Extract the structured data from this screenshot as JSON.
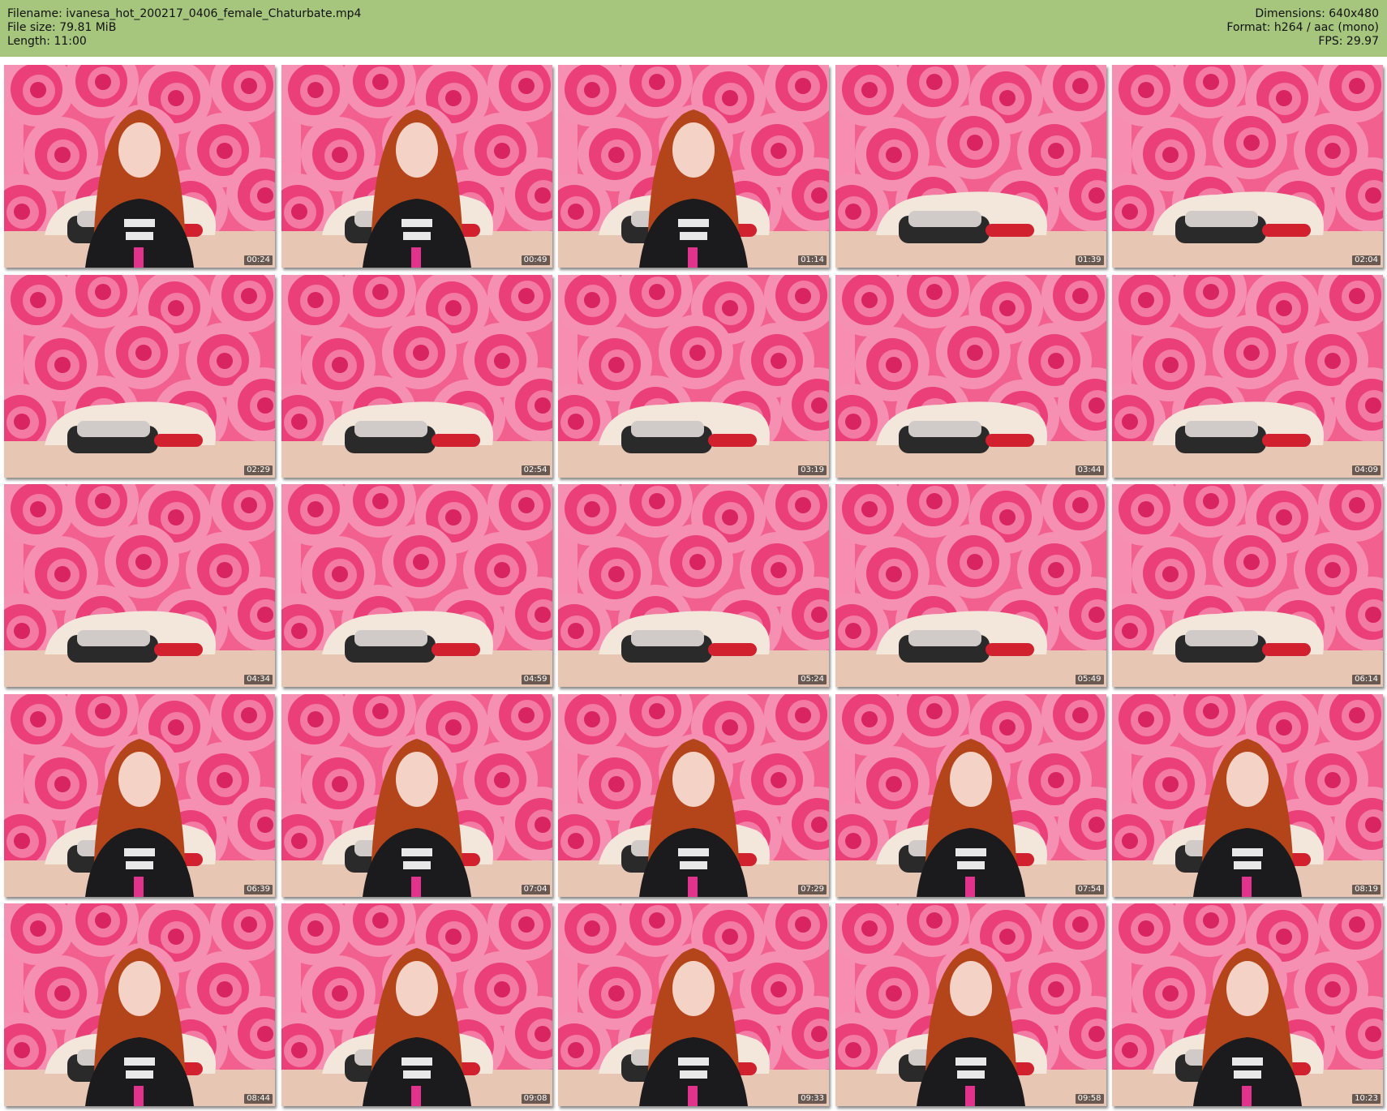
{
  "header": {
    "left": [
      "Filename: ivanesa_hot_200217_0406_female_Chaturbate.mp4",
      "File size: 79.81 MiB",
      "Length: 11:00"
    ],
    "right": [
      "Dimensions: 640x480",
      "Format: h264 / aac (mono)",
      "FPS: 29.97"
    ]
  },
  "colors": {
    "header_bg": "#a7c67d",
    "wallpaper": "#f1608f",
    "hair": "#b4451b",
    "shirt": "#1b1a1c"
  },
  "thumbnails": [
    {
      "time": "00:24",
      "subject": "person"
    },
    {
      "time": "00:49",
      "subject": "person"
    },
    {
      "time": "01:14",
      "subject": "person"
    },
    {
      "time": "01:39",
      "subject": "empty-bed"
    },
    {
      "time": "02:04",
      "subject": "empty-bed"
    },
    {
      "time": "02:29",
      "subject": "empty-bed"
    },
    {
      "time": "02:54",
      "subject": "empty-bed"
    },
    {
      "time": "03:19",
      "subject": "empty-bed"
    },
    {
      "time": "03:44",
      "subject": "empty-bed"
    },
    {
      "time": "04:09",
      "subject": "empty-bed"
    },
    {
      "time": "04:34",
      "subject": "empty-bed"
    },
    {
      "time": "04:59",
      "subject": "empty-bed"
    },
    {
      "time": "05:24",
      "subject": "empty-bed"
    },
    {
      "time": "05:49",
      "subject": "empty-bed"
    },
    {
      "time": "06:14",
      "subject": "empty-bed"
    },
    {
      "time": "06:39",
      "subject": "person"
    },
    {
      "time": "07:04",
      "subject": "person"
    },
    {
      "time": "07:29",
      "subject": "person"
    },
    {
      "time": "07:54",
      "subject": "person"
    },
    {
      "time": "08:19",
      "subject": "person"
    },
    {
      "time": "08:44",
      "subject": "person"
    },
    {
      "time": "09:08",
      "subject": "person"
    },
    {
      "time": "09:33",
      "subject": "person"
    },
    {
      "time": "09:58",
      "subject": "person"
    },
    {
      "time": "10:23",
      "subject": "person"
    }
  ]
}
